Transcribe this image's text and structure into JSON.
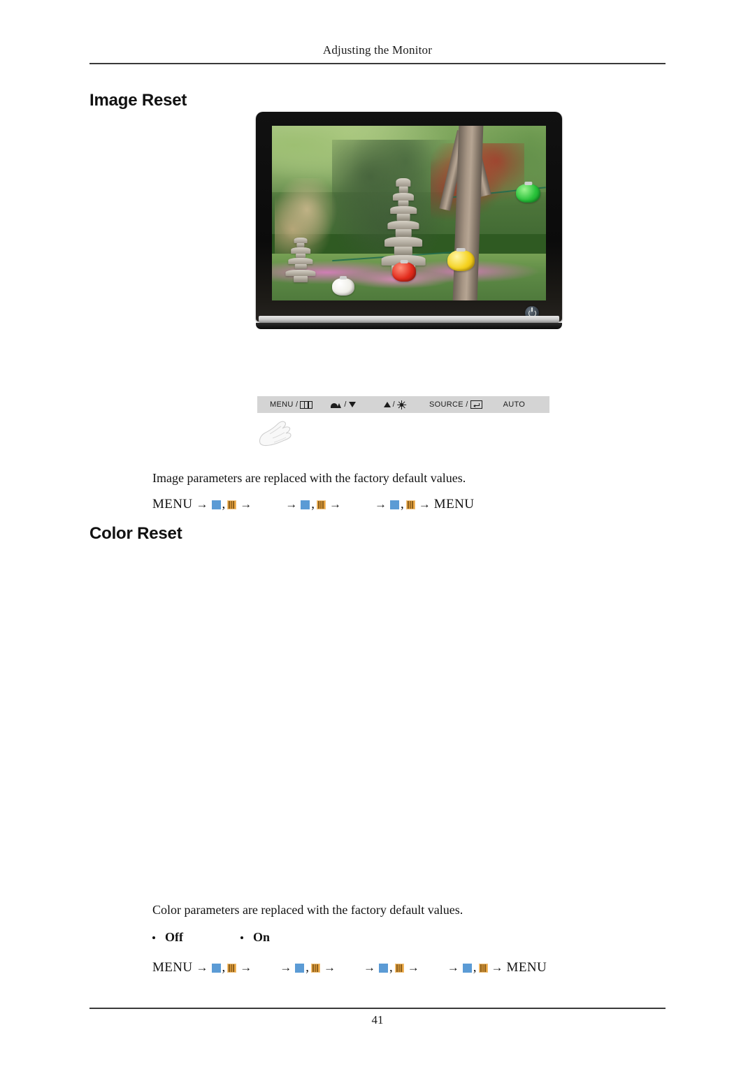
{
  "header": {
    "running_title": "Adjusting the Monitor"
  },
  "sections": [
    {
      "heading": "Image Reset",
      "description": "Image parameters are replaced with the factory default values.",
      "menu_path": {
        "start_label": "MENU",
        "end_label": "MENU",
        "groups": 3
      }
    },
    {
      "heading": "Color Reset",
      "description": "Color parameters are replaced with the factory default values.",
      "options": [
        "Off",
        "On"
      ],
      "menu_path": {
        "start_label": "MENU",
        "end_label": "MENU",
        "groups": 4
      }
    }
  ],
  "control_panel": {
    "buttons": [
      {
        "label": "MENU /",
        "icon": "osd-menu-icon"
      },
      {
        "label": "/",
        "icon": "magicbright-icon",
        "second_icon": "triangle-down-icon"
      },
      {
        "label": "/",
        "icon": "triangle-up-icon",
        "second_icon": "brightness-sun-icon"
      },
      {
        "label": "SOURCE /",
        "icon": "enter-icon"
      },
      {
        "label": "AUTO",
        "icon": ""
      }
    ],
    "background_color": "#d4d4d4"
  },
  "monitor_image": {
    "alt": "LCD monitor displaying a garden scene with stone pagodas, trees and paper lanterns",
    "power_button_icon": "power-icon"
  },
  "arrow_glyph": "→",
  "comma_glyph": ",",
  "colors": {
    "swatch_blue": "#5b9bd5",
    "swatch_orange": "#e8a33d",
    "rule": "#3a3a3a"
  },
  "footer": {
    "page_number": "41"
  }
}
